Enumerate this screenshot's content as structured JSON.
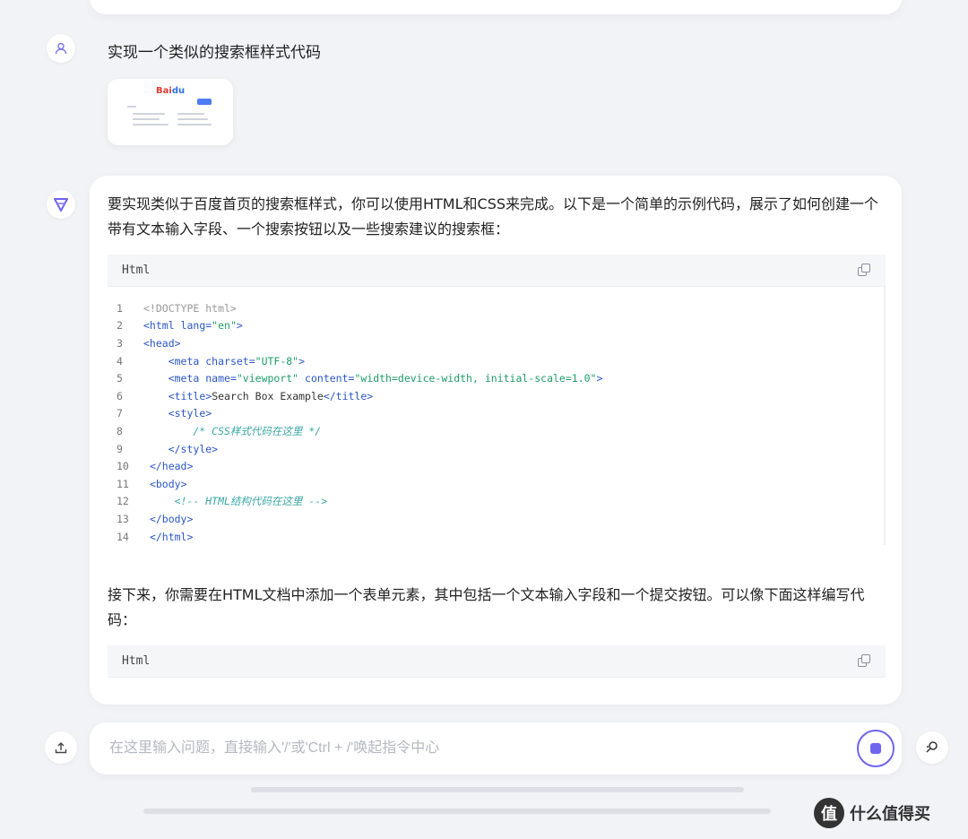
{
  "user_message": {
    "text": "实现一个类似的搜索框样式代码"
  },
  "thumbnail": {
    "logo_left": "Bai",
    "logo_right": "du"
  },
  "ai_message": {
    "intro": "要实现类似于百度首页的搜索框样式，你可以使用HTML和CSS来完成。以下是一个简单的示例代码，展示了如何创建一个带有文本输入字段、一个搜索按钮以及一些搜索建议的搜索框：",
    "code_block_1": {
      "language": "Html",
      "lines": [
        "<!DOCTYPE html>",
        "<html lang=\"en\">",
        "<head>",
        "    <meta charset=\"UTF-8\">",
        "    <meta name=\"viewport\" content=\"width=device-width, initial-scale=1.0\">",
        "    <title>Search Box Example</title>",
        "    <style>",
        "        /* CSS样式代码在这里 */",
        "    </style>",
        " </head>",
        " <body>",
        "     <!-- HTML结构代码在这里 -->",
        " </body>",
        " </html>"
      ]
    },
    "followup": "接下来，你需要在HTML文档中添加一个表单元素，其中包括一个文本输入字段和一个提交按钮。可以像下面这样编写代码：",
    "code_block_2": {
      "language": "Html"
    }
  },
  "input": {
    "placeholder": "在这里输入问题，直接输入'/'或'Ctrl + /'唤起指令中心"
  },
  "icons": {
    "user": "user-icon",
    "assistant": "assistant-logo-icon",
    "copy": "copy-icon",
    "upload": "upload-icon",
    "stop": "stop-icon",
    "search": "search-icon"
  },
  "colors": {
    "accent": "#6f63f0",
    "background": "#f2f3f7",
    "tag": "#2a56c6",
    "string": "#1e9c6a",
    "comment": "#3aa7a4"
  },
  "watermark": {
    "glyph": "值",
    "text": "什么值得买"
  }
}
